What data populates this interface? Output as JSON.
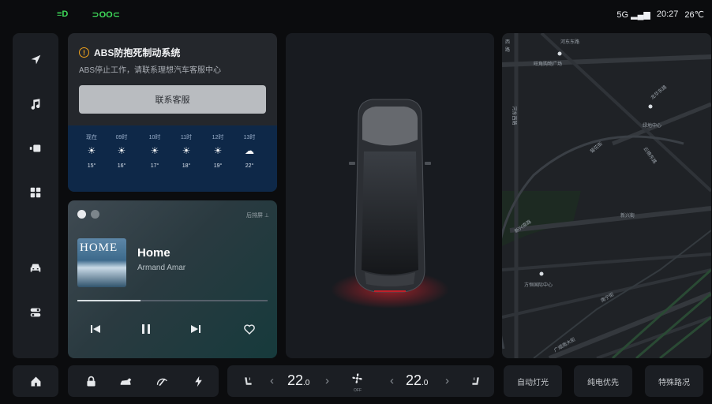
{
  "status_bar": {
    "left_indicators": [
      "≡D",
      "⊃OO⊂"
    ],
    "network": "5G",
    "time": "20:27",
    "temperature": "26℃",
    "indicator_color": "#3fdc5a"
  },
  "sidebar": {
    "items": [
      {
        "icon": "navigation-arrow-icon"
      },
      {
        "icon": "music-note-icon"
      },
      {
        "icon": "media-video-icon"
      },
      {
        "icon": "apps-grid-icon"
      },
      {
        "icon": "car-icon"
      },
      {
        "icon": "settings-toggle-icon"
      }
    ]
  },
  "alert": {
    "icon_text": "!",
    "title": "ABS防抱死制动系统",
    "message": "ABS停止工作，请联系理想汽车客服中心",
    "button_label": "联系客服",
    "warning_color": "#f2a31b"
  },
  "weather": [
    {
      "time": "现在",
      "icon": "☀",
      "temp": "15°"
    },
    {
      "time": "09时",
      "icon": "☀",
      "temp": "16°"
    },
    {
      "time": "10时",
      "icon": "☀",
      "temp": "17°"
    },
    {
      "time": "11时",
      "icon": "☀",
      "temp": "18°"
    },
    {
      "time": "12时",
      "icon": "☀",
      "temp": "19°"
    },
    {
      "time": "13时",
      "icon": "☁",
      "temp": "22°"
    }
  ],
  "music": {
    "rear_screen_label": "后排屏 ⊥",
    "album_text": "HOME",
    "title": "Home",
    "artist": "Armand Amar",
    "progress_fraction": 0.33
  },
  "map": {
    "labels": {
      "east_road": "河东东路",
      "plaza": "旺角购物广场",
      "road_ne": "龙华东路",
      "cross_road": "河东西路",
      "mid_road": "菊花街",
      "park": "绿地中心",
      "road_e": "云锦东路",
      "south_st": "新兴南路",
      "xinxi": "新兴街",
      "fangheng": "方恒国际中心",
      "bottom_road": "南宁街",
      "bottom2": "广顺南大街",
      "xi": "西",
      "lu": "路"
    }
  },
  "dock": {
    "left_temp": "22",
    "left_temp_decimal": ".0",
    "right_temp": "22",
    "right_temp_decimal": ".0",
    "arrow_left": "‹",
    "arrow_right": "›",
    "fan_state": "OFF",
    "pills": [
      "自动灯光",
      "纯电优先",
      "特殊路况"
    ]
  }
}
